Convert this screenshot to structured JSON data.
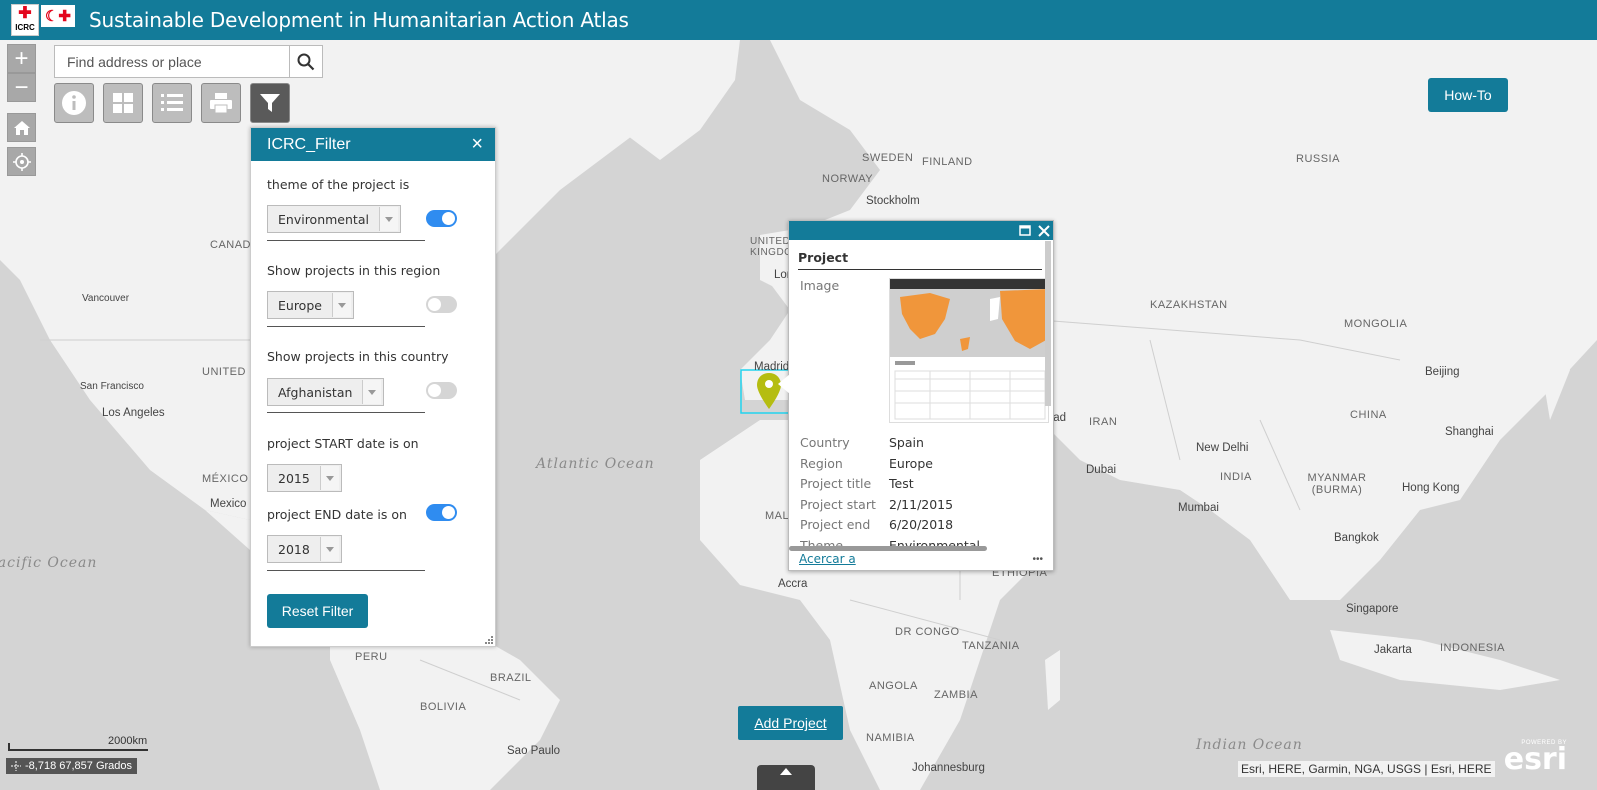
{
  "header": {
    "title": "Sustainable Development in Humanitarian Action Atlas",
    "logo_text": "ICRC"
  },
  "search": {
    "placeholder": "Find address or place"
  },
  "map_controls": {
    "zoom_in": "+",
    "zoom_out": "−"
  },
  "toolbar_icons": [
    "info-icon",
    "basemap-gallery-icon",
    "layer-list-icon",
    "print-icon",
    "filter-icon"
  ],
  "how_to": {
    "label": "How-To"
  },
  "filter_panel": {
    "title": "ICRC_Filter",
    "close": "×",
    "filters": [
      {
        "label": "theme of the project is",
        "value": "Environmental",
        "enabled": true
      },
      {
        "label": "Show projects in this region",
        "value": "Europe",
        "enabled": false
      },
      {
        "label": "Show projects in this country",
        "value": "Afghanistan",
        "enabled": false
      },
      {
        "label": "project START date is on",
        "value": "2015",
        "enabled": null
      },
      {
        "label": "project END date is on",
        "value": "2018",
        "enabled": true
      }
    ],
    "reset_label": "Reset Filter"
  },
  "popup": {
    "title": "Project",
    "image_label": "Image",
    "fields": [
      {
        "key": "Country",
        "value": "Spain"
      },
      {
        "key": "Region",
        "value": "Europe"
      },
      {
        "key": "Project title",
        "value": "Test"
      },
      {
        "key": "Project start",
        "value": "2/11/2015"
      },
      {
        "key": "Project end",
        "value": "6/20/2018"
      },
      {
        "key": "Theme",
        "value": "Environmental"
      }
    ],
    "zoom_link": "Acercar a",
    "more": "•••"
  },
  "map_labels": {
    "countries": [
      "SWEDEN",
      "FINLAND",
      "NORWAY",
      "RUSSIA",
      "UNITED KINGDOM",
      "CANADA",
      "KAZAKHSTAN",
      "MONGOLIA",
      "UNITED STATES",
      "IRAN",
      "CHINA",
      "MÉXICO",
      "INDIA",
      "MYANMAR (BURMA)",
      "MALI",
      "ETHIOPIA",
      "DR CONGO",
      "TANZANIA",
      "ANGOLA",
      "ZAMBIA",
      "NAMIBIA",
      "PERU",
      "BRAZIL",
      "BOLIVIA",
      "INDONESIA"
    ],
    "cities": [
      "Stockholm",
      "London",
      "Madrid",
      "Vancouver",
      "San Francisco",
      "Los Angeles",
      "Mexico",
      "Beijing",
      "Shanghai",
      "New Delhi",
      "Dubai",
      "Mumbai",
      "Hong Kong",
      "Bangkok",
      "Singapore",
      "Jakarta",
      "Accra",
      "Sao Paulo",
      "Johannesburg",
      "Baghdad"
    ],
    "oceans": [
      "Atlantic Ocean",
      "Pacific Ocean",
      "Indian Ocean"
    ]
  },
  "add_project": {
    "label": "Add Project"
  },
  "scale": {
    "label": "2000km"
  },
  "coordinates": {
    "text": "-8,718 67,857 Grados"
  },
  "attribution": {
    "text": "Esri, HERE, Garmin, NGA, USGS | Esri, HERE"
  },
  "esri_logo": {
    "small": "POWERED BY",
    "big": "esri"
  },
  "colors": {
    "brand": "#137b99",
    "toggle_on": "#2f8cf0",
    "marker": "#b5bd11",
    "map_land": "#f2f2f2",
    "map_water": "#d4d4d4"
  }
}
